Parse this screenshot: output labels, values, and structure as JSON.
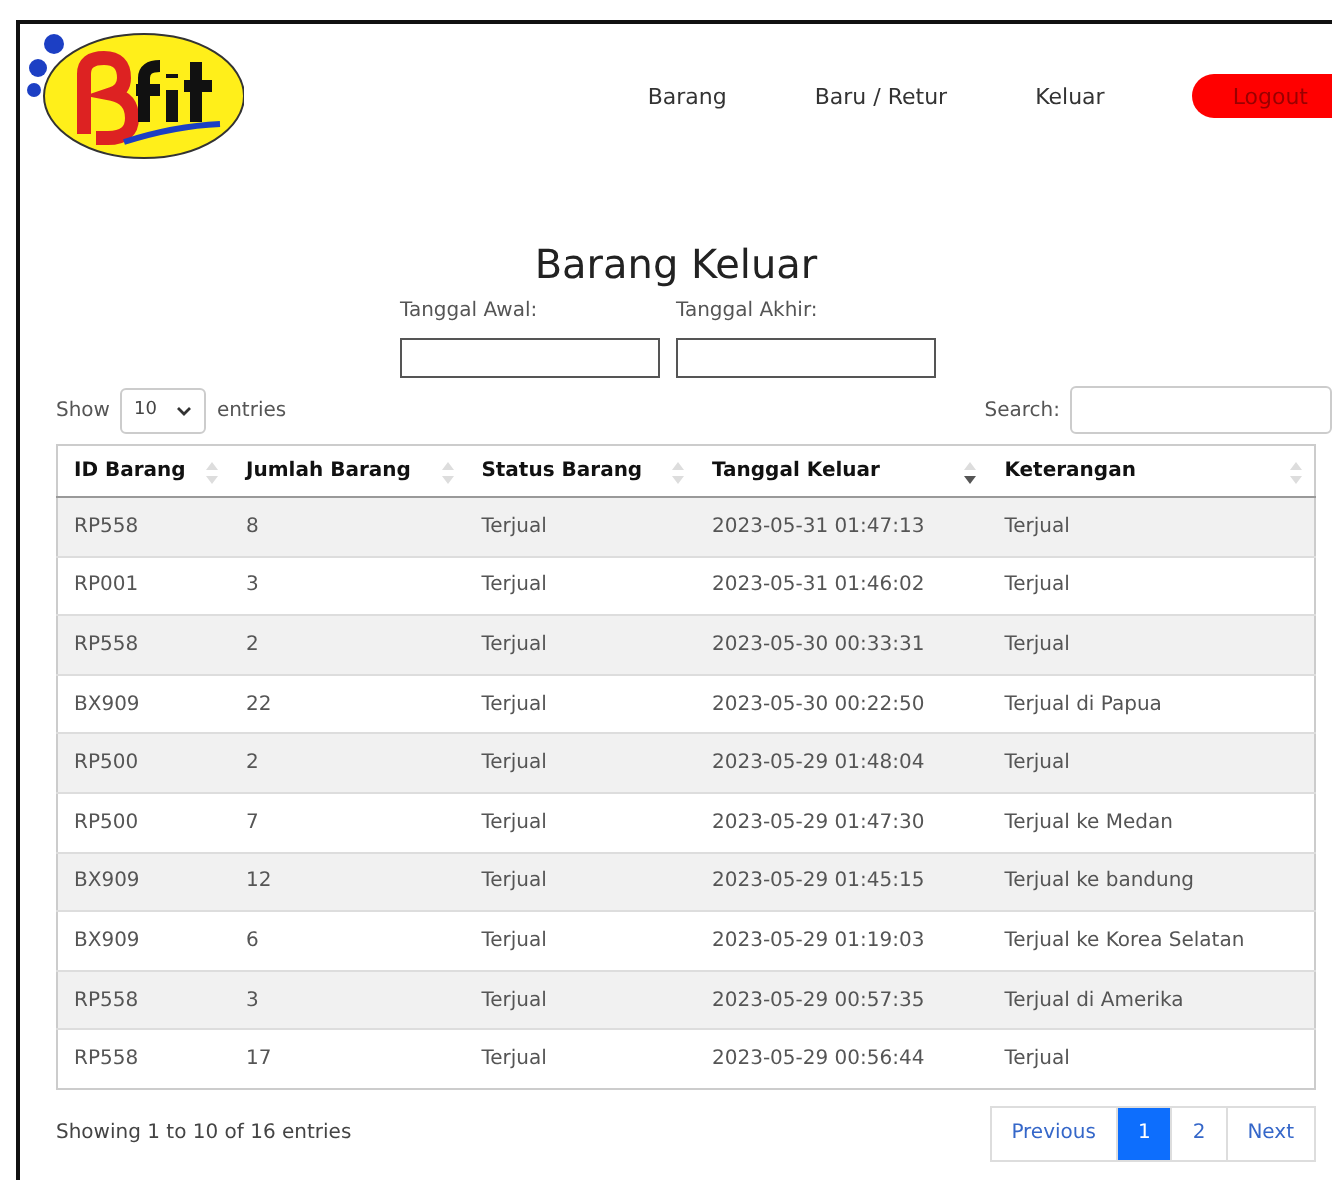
{
  "nav": {
    "items": [
      "Barang",
      "Baru / Retur",
      "Keluar"
    ],
    "logout": "Logout"
  },
  "title": "Barang Keluar",
  "filters": [
    {
      "label": "Tanggal Awal:"
    },
    {
      "label": "Tanggal Akhir:"
    }
  ],
  "length": {
    "before": "Show",
    "value": "10",
    "after": "entries"
  },
  "search": {
    "label": "Search:"
  },
  "table": {
    "columns": [
      {
        "label": "ID Barang",
        "sorted": false
      },
      {
        "label": "Jumlah Barang",
        "sorted": false
      },
      {
        "label": "Status Barang",
        "sorted": false
      },
      {
        "label": "Tanggal Keluar",
        "sorted": true
      },
      {
        "label": "Keterangan",
        "sorted": false
      }
    ],
    "rows": [
      [
        "RP558",
        "8",
        "Terjual",
        "2023-05-31 01:47:13",
        "Terjual"
      ],
      [
        "RP001",
        "3",
        "Terjual",
        "2023-05-31 01:46:02",
        "Terjual"
      ],
      [
        "RP558",
        "2",
        "Terjual",
        "2023-05-30 00:33:31",
        "Terjual"
      ],
      [
        "BX909",
        "22",
        "Terjual",
        "2023-05-30 00:22:50",
        "Terjual di Papua"
      ],
      [
        "RP500",
        "2",
        "Terjual",
        "2023-05-29 01:48:04",
        "Terjual"
      ],
      [
        "RP500",
        "7",
        "Terjual",
        "2023-05-29 01:47:30",
        "Terjual ke Medan"
      ],
      [
        "BX909",
        "12",
        "Terjual",
        "2023-05-29 01:45:15",
        "Terjual ke bandung"
      ],
      [
        "BX909",
        "6",
        "Terjual",
        "2023-05-29 01:19:03",
        "Terjual ke Korea Selatan"
      ],
      [
        "RP558",
        "3",
        "Terjual",
        "2023-05-29 00:57:35",
        "Terjual di Amerika"
      ],
      [
        "RP558",
        "17",
        "Terjual",
        "2023-05-29 00:56:44",
        "Terjual"
      ]
    ]
  },
  "info": "Showing 1 to 10 of 16 entries",
  "pagination": {
    "previous": "Previous",
    "pages": [
      {
        "label": "1",
        "selected": true
      },
      {
        "label": "2",
        "selected": false
      }
    ],
    "next": "Next"
  }
}
